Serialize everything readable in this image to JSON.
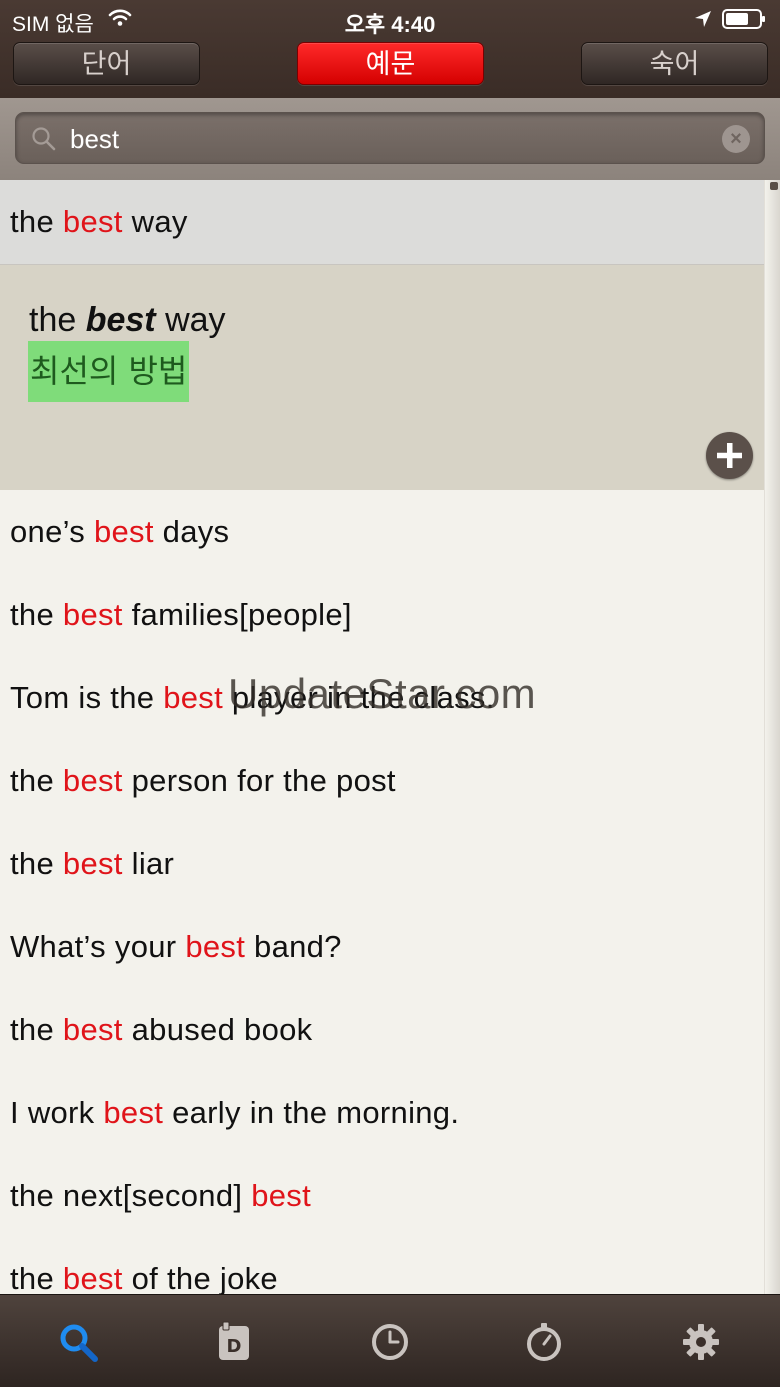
{
  "status_bar": {
    "carrier": "SIM 없음",
    "time": "오후 4:40"
  },
  "segments": {
    "words": "단어",
    "examples": "예문",
    "idioms": "숙어",
    "active": "examples"
  },
  "search": {
    "value": "best"
  },
  "selected_item": {
    "prefix": "the ",
    "highlight": "best",
    "suffix": " way"
  },
  "detail": {
    "prefix": "the ",
    "bold": "best",
    "suffix": " way",
    "translation": "최선의 방법"
  },
  "results": [
    {
      "prefix": "one’s ",
      "highlight": "best",
      "suffix": " days"
    },
    {
      "prefix": "the ",
      "highlight": "best",
      "suffix": " families[people]"
    },
    {
      "prefix": "Tom is the ",
      "highlight": "best",
      "suffix": " player in the class."
    },
    {
      "prefix": "the ",
      "highlight": "best",
      "suffix": " person for the post"
    },
    {
      "prefix": "the ",
      "highlight": "best",
      "suffix": " liar"
    },
    {
      "prefix": "What’s your ",
      "highlight": "best",
      "suffix": " band?"
    },
    {
      "prefix": "the ",
      "highlight": "best",
      "suffix": " abused book"
    },
    {
      "prefix": "I work ",
      "highlight": "best",
      "suffix": " early in the morning."
    },
    {
      "prefix": "the next[second] ",
      "highlight": "best",
      "suffix": ""
    },
    {
      "prefix": "the ",
      "highlight": "best",
      "suffix": " of the joke"
    }
  ],
  "watermark": "UpdateStar.com",
  "tab_bar": {
    "items": [
      "search-icon",
      "wordbook-icon",
      "history-icon",
      "timer-icon",
      "settings-icon"
    ],
    "active": "search-icon"
  },
  "colors": {
    "highlight": "#e0141a",
    "active_segment": "#ff1a1a",
    "translation_bg": "#7fdc7a",
    "header_bg": "#3f312b"
  }
}
